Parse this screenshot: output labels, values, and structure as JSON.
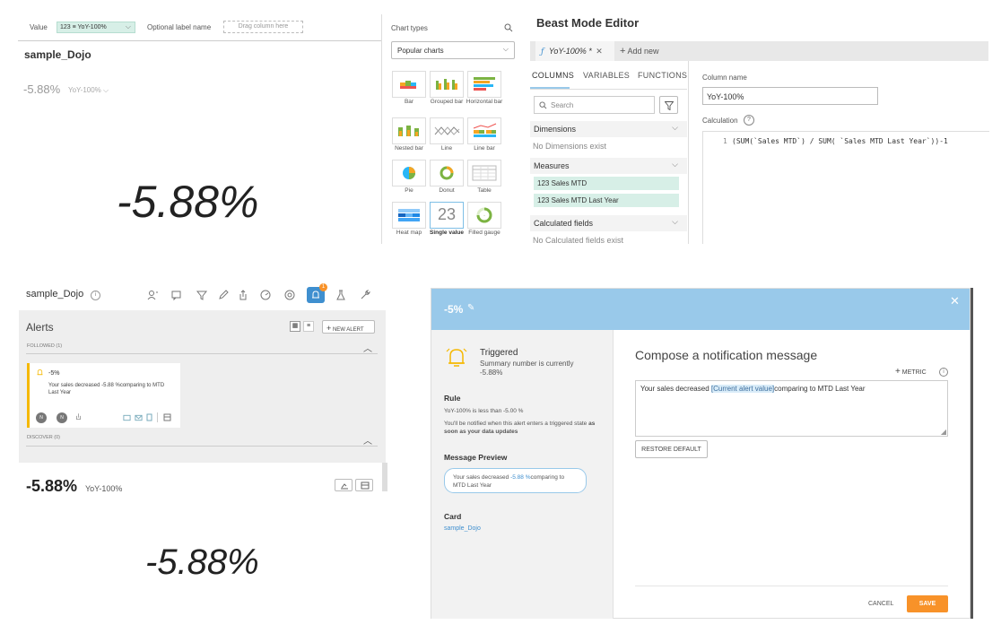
{
  "panel1": {
    "value_label": "Value",
    "value_chip": "123 ≡ YoY-100%",
    "optional_label": "Optional label name",
    "drag_placeholder": "Drag column here",
    "card_title": "sample_Dojo",
    "summary_value": "-5.88%",
    "summary_metric": "YoY-100%",
    "big_value": "-5.88%"
  },
  "chart_types": {
    "title": "Chart types",
    "dropdown": "Popular charts",
    "items": [
      {
        "label": "Bar"
      },
      {
        "label": "Grouped bar"
      },
      {
        "label": "Horizontal bar"
      },
      {
        "label": "Nested bar"
      },
      {
        "label": "Line"
      },
      {
        "label": "Line bar"
      },
      {
        "label": "Pie"
      },
      {
        "label": "Donut"
      },
      {
        "label": "Table"
      },
      {
        "label": "Heat map"
      },
      {
        "label": "Single value"
      },
      {
        "label": "Filled gauge"
      }
    ],
    "single_value_number": "23"
  },
  "beast_mode": {
    "title": "Beast Mode Editor",
    "tab_name": "YoY-100% *",
    "add_new": "Add new",
    "tabs": [
      "COLUMNS",
      "VARIABLES",
      "FUNCTIONS"
    ],
    "search_placeholder": "Search",
    "dimensions_label": "Dimensions",
    "no_dimensions": "No Dimensions exist",
    "measures_label": "Measures",
    "measures": [
      "123  Sales MTD",
      "123  Sales MTD Last Year"
    ],
    "calculated_label": "Calculated fields",
    "no_calculated": "No Calculated fields exist",
    "column_name_label": "Column name",
    "column_name_value": "YoY-100%",
    "calculation_label": "Calculation",
    "line_number": "1",
    "formula": "(SUM(`Sales MTD`) / SUM( `Sales MTD Last Year`))-1"
  },
  "alerts_panel": {
    "card_title": "sample_Dojo",
    "alerts_title": "Alerts",
    "new_alert": "NEW ALERT",
    "followed": "FOLLOWED (1)",
    "alert_name": "-5%",
    "alert_desc": "Your sales decreased -5.88 %comparing to MTD Last Year",
    "discover": "DISCOVER (0)",
    "badge_count": "1",
    "avatar_initial": "N",
    "bottom_value": "-5.88%",
    "bottom_metric": "YoY-100%",
    "big_value": "-5.88%"
  },
  "notification": {
    "header_title": "-5%",
    "triggered_title": "Triggered",
    "triggered_text": "Summary number is currently -5.88%",
    "rule_heading": "Rule",
    "rule_text": "YoY-100% is less than -5.00 %",
    "notify_text_1": "You'll be notified when this alert enters a triggered state",
    "notify_text_2": "as soon as your data updates",
    "preview_heading": "Message Preview",
    "preview_text_1": "Your sales decreased",
    "preview_value": "-5.88 %",
    "preview_text_2": "comparing to MTD Last Year",
    "card_heading": "Card",
    "card_link": "sample_Dojo",
    "compose_title": "Compose a notification message",
    "metric_btn": "METRIC",
    "message_1": "Your sales decreased ",
    "message_token": "[Current alert value]",
    "message_2": "comparing to MTD Last Year",
    "restore_default": "RESTORE DEFAULT",
    "cancel": "CANCEL",
    "save": "SAVE"
  },
  "colors": {
    "accent_blue": "#99c9ea",
    "save_orange": "#f89229",
    "alert_yellow": "#f5b800",
    "chip_green": "#d7efe7",
    "link_blue": "#3f8fcf"
  }
}
